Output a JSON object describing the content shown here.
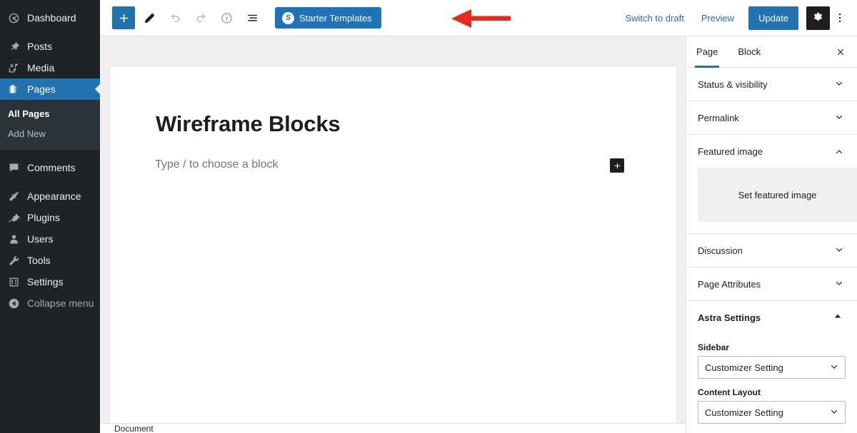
{
  "admin_menu": {
    "items": [
      {
        "label": "Dashboard",
        "icon": "dashboard-icon",
        "state": "normal"
      },
      {
        "label": "Posts",
        "icon": "pin-icon",
        "state": "normal"
      },
      {
        "label": "Media",
        "icon": "media-icon",
        "state": "normal"
      },
      {
        "label": "Pages",
        "icon": "pages-icon",
        "state": "current"
      },
      {
        "label": "Comments",
        "icon": "comments-icon",
        "state": "normal"
      },
      {
        "label": "Appearance",
        "icon": "paintbrush-icon",
        "state": "normal"
      },
      {
        "label": "Plugins",
        "icon": "plug-icon",
        "state": "normal"
      },
      {
        "label": "Users",
        "icon": "user-icon",
        "state": "normal"
      },
      {
        "label": "Tools",
        "icon": "wrench-icon",
        "state": "normal"
      },
      {
        "label": "Settings",
        "icon": "sliders-icon",
        "state": "normal"
      },
      {
        "label": "Collapse menu",
        "icon": "collapse-arrow-icon",
        "state": "dim"
      }
    ],
    "submenu": {
      "items": [
        {
          "label": "All Pages",
          "current": true
        },
        {
          "label": "Add New",
          "current": false
        }
      ]
    },
    "highlight_color": "#2271b1",
    "background_color": "#1d2327"
  },
  "header": {
    "tools": [
      {
        "name": "block-inserter-toggle",
        "icon": "plus-icon",
        "style": "primary"
      },
      {
        "name": "tools-edit",
        "icon": "pencil-icon",
        "style": "normal"
      },
      {
        "name": "undo",
        "icon": "undo-icon",
        "style": "disabled"
      },
      {
        "name": "redo",
        "icon": "redo-icon",
        "style": "disabled"
      },
      {
        "name": "details",
        "icon": "info-icon",
        "style": "muted"
      },
      {
        "name": "list-view",
        "icon": "list-view-icon",
        "style": "normal"
      }
    ],
    "starter_templates": {
      "label": "Starter Templates",
      "icon_glyph": "S",
      "background_color": "#1d72b8"
    },
    "annotation": {
      "type": "arrow",
      "color": "#e8291c",
      "points_to": "starter-templates-button"
    },
    "switch_to_draft_label": "Switch to draft",
    "preview_label": "Preview",
    "update_label": "Update",
    "update_color": "#2271b1",
    "settings_icon": "gear-icon",
    "more_icon": "more-vertical-icon"
  },
  "editor": {
    "post_title": "Wireframe Blocks",
    "block_placeholder": "Type / to choose a block",
    "inserter_icon": "plus-icon",
    "breadcrumb": "Document"
  },
  "settings_sidebar": {
    "tabs": [
      {
        "label": "Page",
        "active": true
      },
      {
        "label": "Block",
        "active": false
      }
    ],
    "close_icon": "close-icon",
    "panels": [
      {
        "title": "Status & visibility",
        "expanded": false,
        "bold": false
      },
      {
        "title": "Permalink",
        "expanded": false,
        "bold": false
      },
      {
        "title": "Featured image",
        "expanded": true,
        "bold": false
      },
      {
        "title": "Discussion",
        "expanded": false,
        "bold": false
      },
      {
        "title": "Page Attributes",
        "expanded": false,
        "bold": false
      },
      {
        "title": "Astra Settings",
        "expanded": true,
        "bold": true
      }
    ],
    "featured_image_placeholder": "Set featured image",
    "astra": {
      "sidebar_label": "Sidebar",
      "sidebar_value": "Customizer Setting",
      "content_layout_label": "Content Layout",
      "content_layout_value": "Customizer Setting"
    }
  }
}
